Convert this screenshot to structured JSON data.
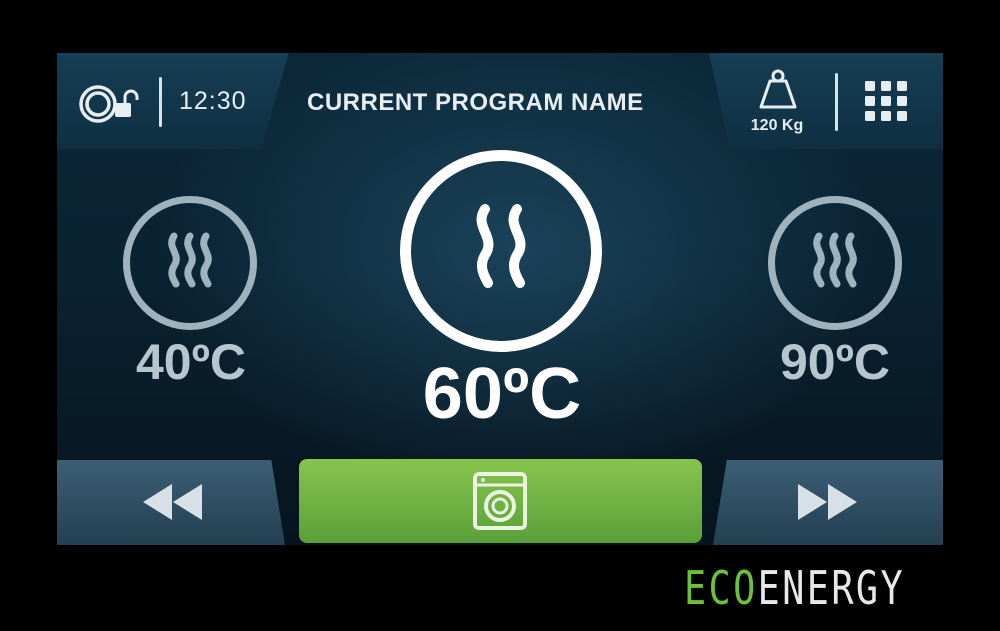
{
  "header": {
    "time": "12:30",
    "program_name": "CURRENT PROGRAM NAME",
    "load_weight": "120 Kg",
    "icons": [
      "door-lock-open-icon",
      "weight-icon",
      "menu-grid-icon"
    ]
  },
  "temperatures": {
    "left": "40ºC",
    "center": "60ºC",
    "right": "90ºC",
    "selected": "60ºC"
  },
  "controls": {
    "icons": [
      "rewind-icon",
      "washing-machine-icon",
      "fast-forward-icon"
    ]
  },
  "brand": {
    "eco": "ECO",
    "energy": "ENERGY"
  },
  "colors": {
    "accent_green": "#6bc23a",
    "start_button": "#72b344",
    "panel_bg": "#0a2232",
    "text": "#e6eef2"
  }
}
